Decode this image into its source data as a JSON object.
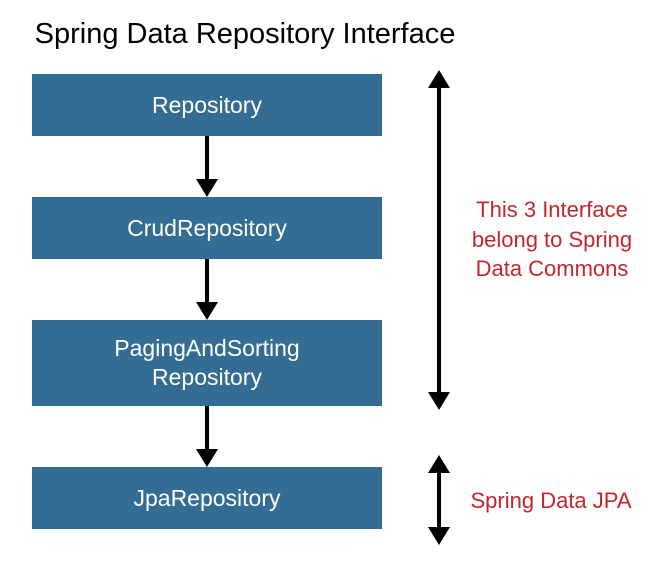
{
  "title": "Spring Data Repository Interface",
  "boxes": {
    "repository": "Repository",
    "crud": "CrudRepository",
    "paging": "PagingAndSorting\nRepository",
    "jpa": "JpaRepository"
  },
  "notes": {
    "commons": "This 3 Interface\nbelong to Spring\nData Commons",
    "jpa": "Spring Data JPA"
  },
  "colors": {
    "box_bg": "#336d94",
    "note_text": "#c1272d"
  }
}
